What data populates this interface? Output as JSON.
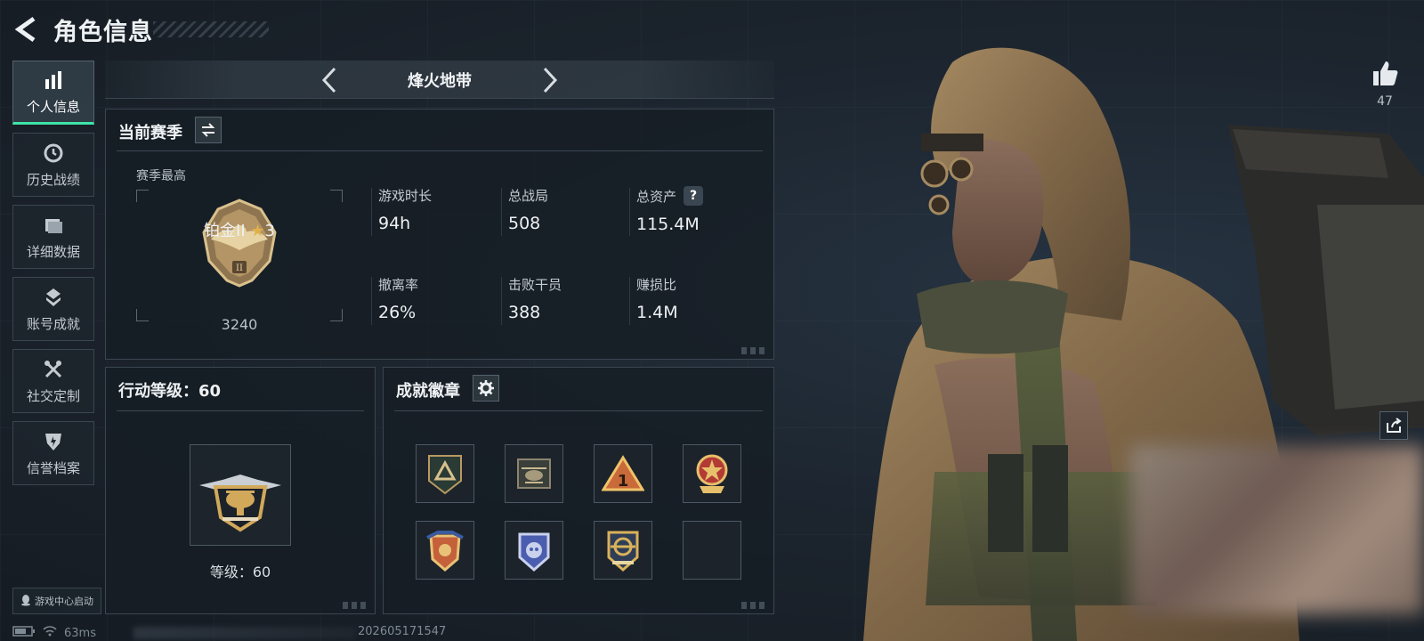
{
  "header": {
    "title": "角色信息"
  },
  "sidebar": {
    "items": [
      {
        "label": "个人信息",
        "icon": "bar-chart-icon",
        "active": true
      },
      {
        "label": "历史战绩",
        "icon": "history-icon"
      },
      {
        "label": "详细数据",
        "icon": "folder-icon"
      },
      {
        "label": "账号成就",
        "icon": "achievement-icon"
      },
      {
        "label": "社交定制",
        "icon": "tools-icon"
      },
      {
        "label": "信誉档案",
        "icon": "shield-icon"
      }
    ],
    "game_center": "游戏中心启动"
  },
  "mode": {
    "title": "烽火地带"
  },
  "season": {
    "heading": "当前赛季",
    "best_label": "赛季最高",
    "rank_name": "铂金II",
    "rank_stars": "3",
    "rank_score": "3240",
    "stats": [
      {
        "label": "游戏时长",
        "value": "94h"
      },
      {
        "label": "总战局",
        "value": "508"
      },
      {
        "label": "总资产",
        "value": "115.4M",
        "help": "?"
      },
      {
        "label": "撤离率",
        "value": "26%"
      },
      {
        "label": "击败干员",
        "value": "388"
      },
      {
        "label": "赚损比",
        "value": "1.4M"
      }
    ]
  },
  "level": {
    "heading": "行动等级：60",
    "text": "等级：60"
  },
  "badges": {
    "heading": "成就徽章",
    "items": [
      "triangle-badge",
      "helicopter-badge",
      "number-one-badge",
      "star-medal-badge",
      "wings-badge",
      "skull-badge",
      "gold-emblem-badge",
      "empty-slot"
    ]
  },
  "status": {
    "ping": "63ms",
    "build": "202605171547"
  },
  "social": {
    "likes": "47"
  },
  "colors": {
    "accent": "#3fe3a8",
    "gold": "#e0b04a",
    "panel_border": "#3a4651"
  }
}
